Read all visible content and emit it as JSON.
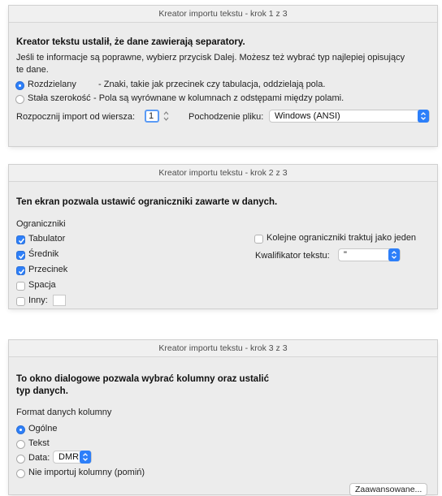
{
  "step1": {
    "title": "Kreator importu tekstu - krok 1 z 3",
    "heading": "Kreator tekstu ustalił, że dane zawierają separatory.",
    "desc_line1": "Jeśli te informacje są poprawne, wybierz przycisk Dalej. Możesz też wybrać typ najlepiej opisujący",
    "desc_line2": "te dane.",
    "options": [
      {
        "label": "Rozdzielany",
        "desc": "- Znaki, takie jak przecinek czy tabulacja, oddzielają pola.",
        "selected": true
      },
      {
        "label": "Stała szerokość",
        "desc": "- Pola są wyrównane w kolumnach z odstępami między polami.",
        "selected": false
      }
    ],
    "start_row_label": "Rozpocznij import od wiersza:",
    "start_row_value": "1",
    "origin_label": "Pochodzenie pliku:",
    "origin_value": "Windows (ANSI)"
  },
  "step2": {
    "title": "Kreator importu tekstu - krok 2 z 3",
    "heading": "Ten ekran pozwala ustawić ograniczniki zawarte w danych.",
    "group_label": "Ograniczniki",
    "delimiters": [
      {
        "label": "Tabulator",
        "checked": true
      },
      {
        "label": "Średnik",
        "checked": true
      },
      {
        "label": "Przecinek",
        "checked": true
      },
      {
        "label": "Spacja",
        "checked": false
      },
      {
        "label": "Inny:",
        "checked": false
      }
    ],
    "consecutive_label": "Kolejne ograniczniki traktuj jako jeden",
    "consecutive_checked": false,
    "qualifier_label": "Kwalifikator tekstu:",
    "qualifier_value": "\""
  },
  "step3": {
    "title": "Kreator importu tekstu - krok 3 z 3",
    "heading_line1": "To okno dialogowe pozwala wybrać kolumny oraz ustalić",
    "heading_line2": "typ danych.",
    "group_label": "Format danych kolumny",
    "formats": [
      {
        "label": "Ogólne",
        "selected": true
      },
      {
        "label": "Tekst",
        "selected": false
      },
      {
        "label": "Data:",
        "selected": false
      },
      {
        "label": "Nie importuj kolumny (pomiń)",
        "selected": false
      }
    ],
    "date_format_value": "DMR",
    "advanced_button": "Zaawansowane..."
  },
  "colors": {
    "accent": "#2d7ff9",
    "dialog_bg": "#ececec"
  }
}
